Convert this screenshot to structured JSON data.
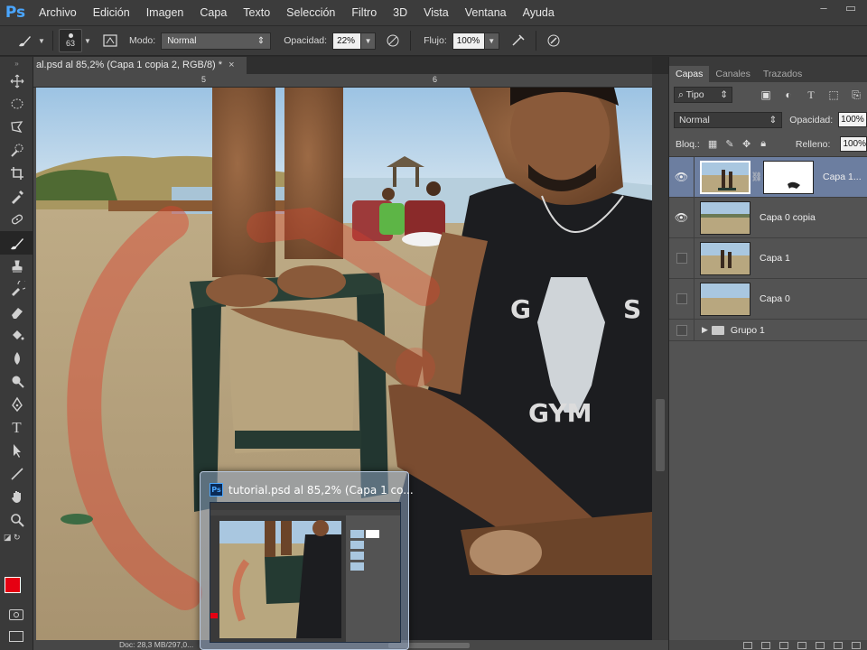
{
  "app": {
    "logo": "Ps"
  },
  "menu": [
    "Archivo",
    "Edición",
    "Imagen",
    "Capa",
    "Texto",
    "Selección",
    "Filtro",
    "3D",
    "Vista",
    "Ventana",
    "Ayuda"
  ],
  "options": {
    "brush_size": "63",
    "mode_label": "Modo:",
    "mode_value": "Normal",
    "opacity_label": "Opacidad:",
    "opacity_value": "22%",
    "flow_label": "Flujo:",
    "flow_value": "100%"
  },
  "document": {
    "tab_title": "al.psd al 85,2% (Capa 1 copia 2, RGB/8) *",
    "close": "×",
    "ruler_marks": [
      "5",
      "6"
    ],
    "status": "Doc: 28,3 MB/297,0..."
  },
  "colors": {
    "foreground": "#e60012",
    "background": "#ffffff",
    "accent": "#4aa6ff"
  },
  "preview": {
    "icon": "Ps",
    "title": "tutorial.psd al 85,2% (Capa 1 co..."
  },
  "layers_panel": {
    "tabs": [
      "Capas",
      "Canales",
      "Trazados"
    ],
    "filter_type": "Tipo",
    "blend_mode": "Normal",
    "opacity_label": "Opacidad:",
    "opacity_value": "100%",
    "lock_label": "Bloq.:",
    "fill_label": "Relleno:",
    "fill_value": "100%",
    "layers": [
      {
        "name": "Capa 1...",
        "visible": true,
        "selected": true,
        "has_mask": true
      },
      {
        "name": "Capa 0 copia",
        "visible": true,
        "selected": false,
        "has_mask": false
      },
      {
        "name": "Capa 1",
        "visible": false,
        "selected": false,
        "has_mask": false
      },
      {
        "name": "Capa 0",
        "visible": false,
        "selected": false,
        "has_mask": false
      }
    ],
    "group_name": "Grupo 1"
  }
}
